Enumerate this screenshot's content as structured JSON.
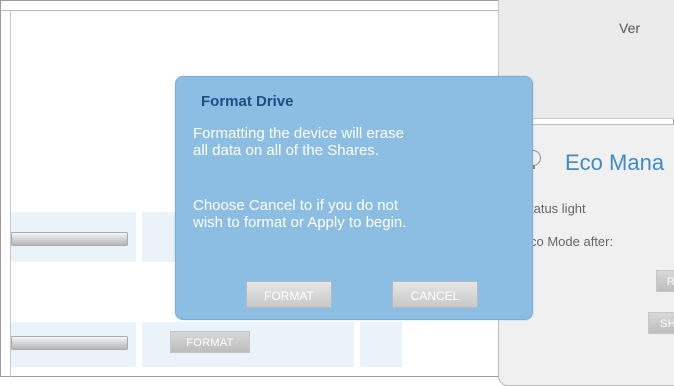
{
  "dialog": {
    "title": "Format Drive",
    "message_line1": "Formatting the device will erase",
    "message_line2": "all data on all of the Shares.",
    "instruction_line1": "Choose Cancel to if you do not",
    "instruction_line2": "wish to format or Apply to begin.",
    "format_button": "FORMAT",
    "cancel_button": "CANCEL"
  },
  "background": {
    "row_format_button": "FORMAT"
  },
  "right_panel": {
    "version_text": "Ver",
    "eco_title": "Eco Mana",
    "status_light_label": "tatus light",
    "eco_mode_label": "co Mode after:",
    "button_r": "R",
    "button_sh": "SH"
  },
  "colors": {
    "dialog_bg": "#8cbde3",
    "dialog_title": "#1c4f82",
    "eco_title": "#3d8cc4"
  }
}
